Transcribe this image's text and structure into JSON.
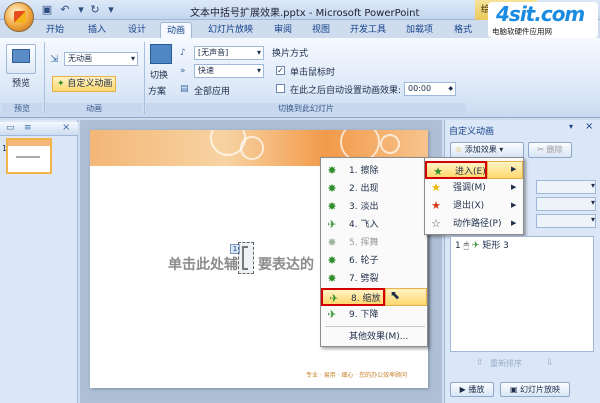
{
  "window": {
    "title": "文本中括号扩展效果.pptx - Microsoft PowerPoint",
    "contextual_tab": "绘图工具"
  },
  "tabs": [
    "开始",
    "插入",
    "设计",
    "动画",
    "幻灯片放映",
    "审阅",
    "视图",
    "开发工具",
    "加载项",
    "格式"
  ],
  "active_tab": "动画",
  "ribbon": {
    "preview_btn": "预览",
    "preview_group": "预览",
    "no_anim": "无动画",
    "custom_anim": "自定义动画",
    "anim_group": "动画",
    "switch_scheme_1": "切换",
    "switch_scheme_2": "方案",
    "sound": "[无声音]",
    "speed": "快速",
    "apply_all": "全部应用",
    "switch_method": "换片方式",
    "on_click": "单击鼠标时",
    "after_time": "在此之后自动设置动画效果:",
    "time_value": "00:00",
    "transition_group": "切换到此幻灯片"
  },
  "slide_panel": {
    "slide_number": "1"
  },
  "slide": {
    "text_left": "单击此处辅",
    "text_right": "要表达的",
    "anim_tag": "1",
    "footer": "专业 · 易用 · 细心 · 您的办公效率顾问"
  },
  "task_pane": {
    "title": "自定义动画",
    "add_effect": "添加效果",
    "remove": "删除",
    "effect_num": "1",
    "effect_name": "矩形 3",
    "reorder": "重新排序",
    "play": "播放",
    "slideshow": "幻灯片放映"
  },
  "effect_menu": [
    {
      "label": "进入(E)",
      "icon": "entrance-star-icon",
      "color": "#2f8f2f"
    },
    {
      "label": "强调(M)",
      "icon": "emphasis-star-icon",
      "color": "#e8b800"
    },
    {
      "label": "退出(X)",
      "icon": "exit-star-icon",
      "color": "#d43a1a"
    },
    {
      "label": "动作路径(P)",
      "icon": "motion-path-star-icon",
      "color": "#ffffff"
    }
  ],
  "entrance_menu": [
    {
      "label": "1. 擦除",
      "disabled": false
    },
    {
      "label": "2. 出现",
      "disabled": false
    },
    {
      "label": "3. 淡出",
      "disabled": false
    },
    {
      "label": "4. 飞入",
      "disabled": false
    },
    {
      "label": "5. 挥舞",
      "disabled": true
    },
    {
      "label": "6. 轮子",
      "disabled": false
    },
    {
      "label": "7. 劈裂",
      "disabled": false
    },
    {
      "label": "8. 缩放",
      "disabled": false
    },
    {
      "label": "9. 下降",
      "disabled": false
    },
    {
      "label": "其他效果(M)...",
      "disabled": false
    }
  ],
  "watermark": {
    "logo": "4sit.com",
    "subtitle": "电脑软硬件应用网"
  }
}
